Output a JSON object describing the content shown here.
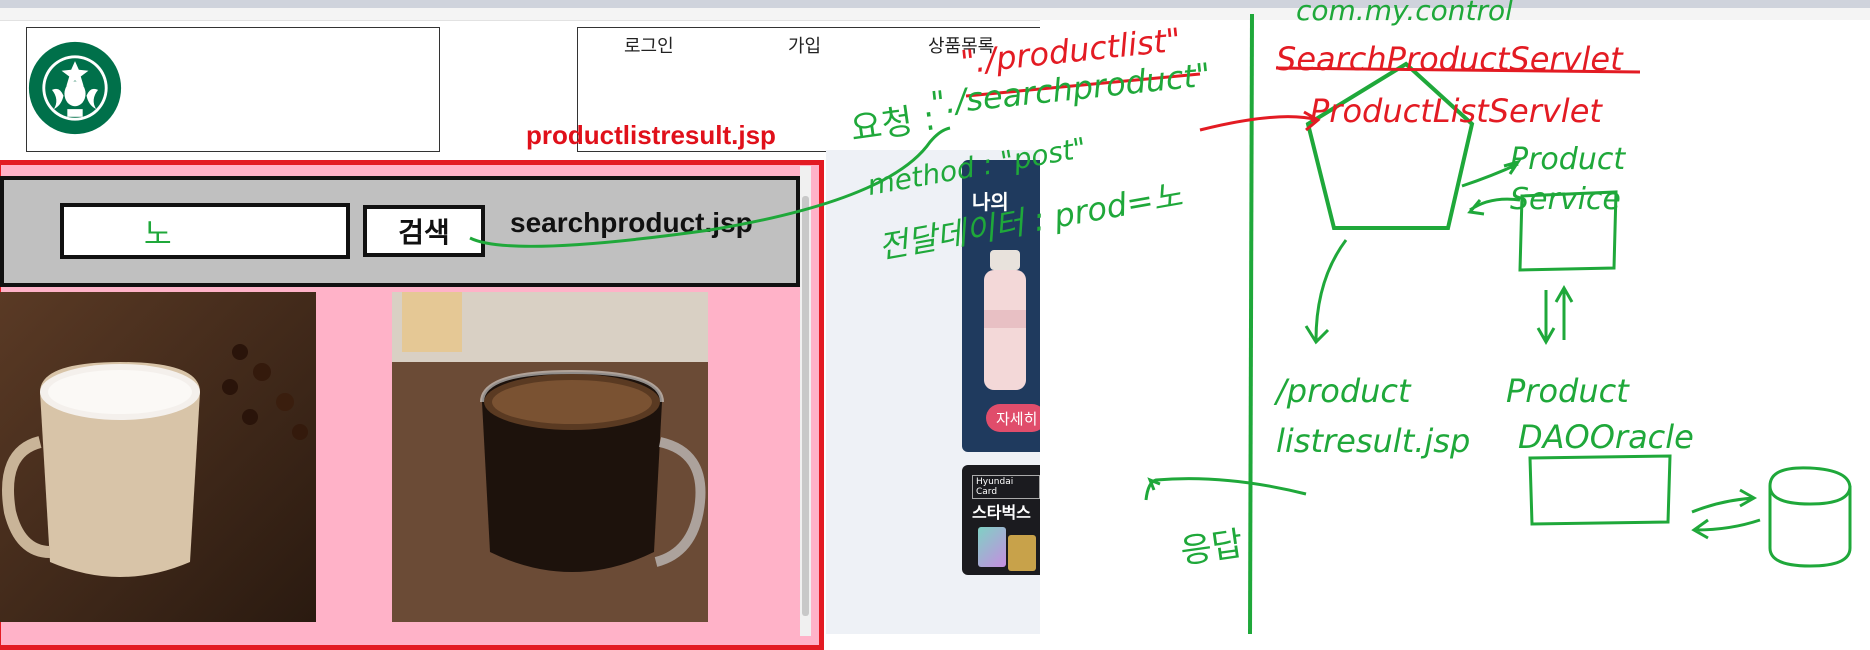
{
  "nav": {
    "login": "로그인",
    "signup": "가입",
    "product_list": "상품목록"
  },
  "result_file_label": "productlistresult.jsp",
  "search": {
    "input_value": "노",
    "button_label": "검색",
    "file_label": "searchproduct.jsp"
  },
  "side_banner": {
    "title_partial": "나의",
    "detail_label": "자세히",
    "card_brand": "Hyundai Card",
    "card_text": "스타벅스"
  },
  "annotations": {
    "request_label": "요청 :",
    "request_url_new": "\"./productlist\"",
    "request_url_old": "\"./searchproduct\"",
    "method": "method : \"post\"",
    "transfer_data": "전달데이터 : prod=노",
    "package": "com.my.control",
    "servlet_old": "SearchProductServlet",
    "servlet_new": "ProductListServlet",
    "service": "Product Service",
    "view_jsp_line1": "/product",
    "view_jsp_line2": "listresult.jsp",
    "dao_line1": "Product",
    "dao_line2": "DAOOracle",
    "response": "응답"
  },
  "colors": {
    "red": "#e31b23",
    "green": "#1fa83a",
    "pink": "#ffb2c8",
    "gray_search": "#c0c0c0"
  }
}
